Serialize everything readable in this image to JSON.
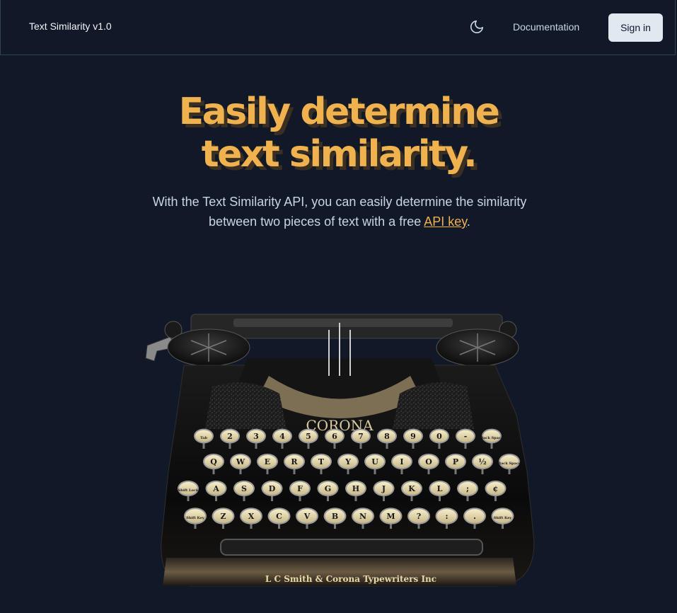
{
  "nav": {
    "brand": "Text Similarity v1.0",
    "theme_icon": "moon-icon",
    "documentation_label": "Documentation",
    "signin_label": "Sign in"
  },
  "hero": {
    "title_line1": "Easily determine",
    "title_line2": "text similarity.",
    "subtitle_before": "With the Text Similarity API, you can easily determine the similarity between two pieces of text with a free ",
    "subtitle_link": "API key",
    "subtitle_after": "."
  },
  "typewriter": {
    "brand_plate": "CORONA",
    "maker_label": "L C Smith & Corona Typewriters Inc",
    "row1": [
      "Tab",
      "2",
      "3",
      "4",
      "5",
      "6",
      "7",
      "8",
      "9",
      "0",
      "-",
      "Back Space"
    ],
    "row2": [
      "Q",
      "W",
      "E",
      "R",
      "T",
      "Y",
      "U",
      "I",
      "O",
      "P",
      "½",
      "Back Space"
    ],
    "row3": [
      "Shift Lock",
      "A",
      "S",
      "D",
      "F",
      "G",
      "H",
      "J",
      "K",
      "L",
      ";",
      "¢"
    ],
    "row4": [
      "Shift Key",
      "Z",
      "X",
      "C",
      "V",
      "B",
      "N",
      "M",
      "?",
      ":",
      ".",
      "Shift Key"
    ]
  },
  "colors": {
    "background": "#111827",
    "accent": "#f0b14f",
    "button_bg": "#e2e8f0"
  }
}
